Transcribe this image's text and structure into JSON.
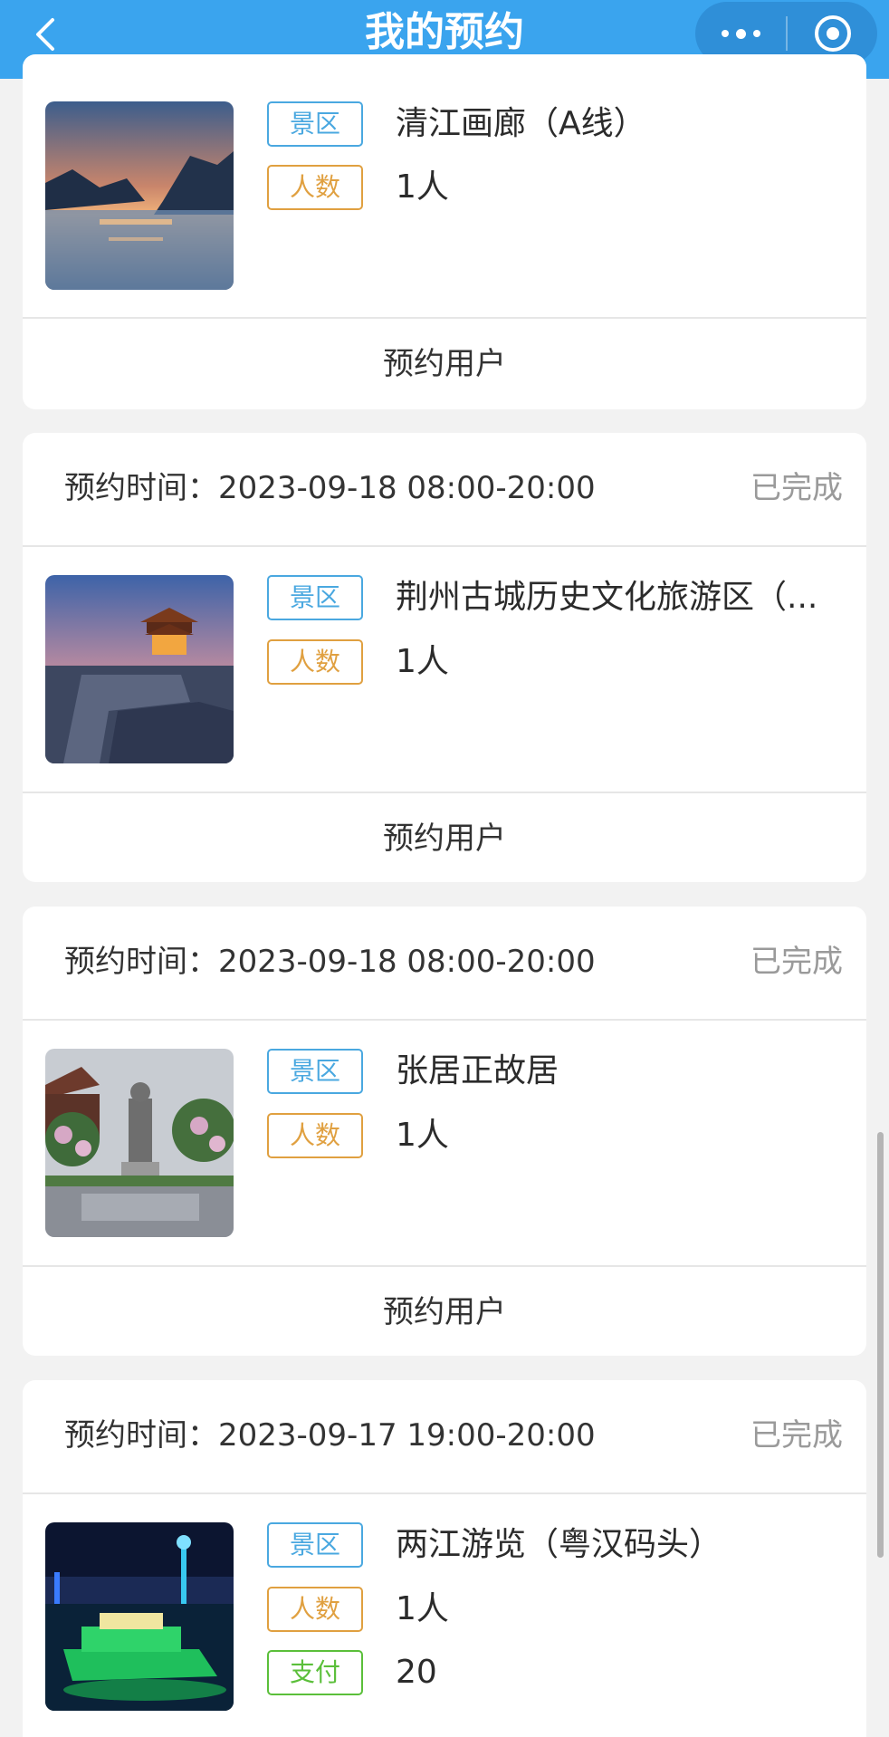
{
  "header": {
    "title": "我的预约"
  },
  "cards": [
    {
      "scenic_tag": "景区",
      "scenic_name": "清江画廊（A线）",
      "people_tag": "人数",
      "people": "1人",
      "footer": "预约用户",
      "image_icon": "lake-sunset-photo"
    },
    {
      "time_label": "预约时间：",
      "time": "2023-09-18 08:00-20:00",
      "status": "已完成",
      "scenic_tag": "景区",
      "scenic_name": "荆州古城历史文化旅游区（...",
      "people_tag": "人数",
      "people": "1人",
      "footer": "预约用户",
      "image_icon": "city-wall-tower-photo"
    },
    {
      "time_label": "预约时间：",
      "time": "2023-09-18 08:00-20:00",
      "status": "已完成",
      "scenic_tag": "景区",
      "scenic_name": "张居正故居",
      "people_tag": "人数",
      "people": "1人",
      "footer": "预约用户",
      "image_icon": "statue-garden-photo"
    },
    {
      "time_label": "预约时间：",
      "time": "2023-09-17 19:00-20:00",
      "status": "已完成",
      "scenic_tag": "景区",
      "scenic_name": "两江游览（粤汉码头）",
      "people_tag": "人数",
      "people": "1人",
      "pay_tag": "支付",
      "pay": "20",
      "image_icon": "night-cruise-photo"
    }
  ],
  "colors": {
    "header_bg": "#3aa4ee",
    "tag_blue": "#4aa8e0",
    "tag_orange": "#e0a040",
    "tag_green": "#5bbf3a",
    "status_gray": "#9a9a9a"
  }
}
